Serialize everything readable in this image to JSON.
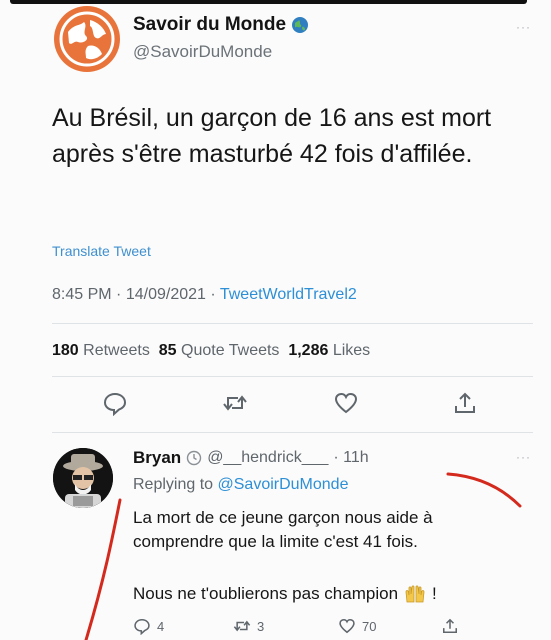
{
  "tweet": {
    "author_name": "Savoir du Monde",
    "author_handle": "@SavoirDuMonde",
    "text": "Au Brésil, un garçon de 16 ans est mort après s'être masturbé 42 fois d'affilée.",
    "translate_label": "Translate Tweet",
    "time": "8:45 PM",
    "date": "14/09/2021",
    "source": "TweetWorldTravel2",
    "retweets_count": "180",
    "retweets_label": "Retweets",
    "quotes_count": "85",
    "quotes_label": "Quote Tweets",
    "likes_count": "1,286",
    "likes_label": "Likes",
    "more": "···"
  },
  "reply": {
    "author_name": "Bryan",
    "author_handle": "@__hendrick___",
    "time": "· 11h",
    "replying_prefix": "Replying to",
    "replying_to": "@SavoirDuMonde",
    "text_line1": "La mort de ce jeune garçon nous aide à comprendre que la limite c'est 41 fois.",
    "text_line2": "Nous ne t'oublierons pas champion",
    "exclaim": "!",
    "reply_count": "4",
    "retweet_count": "3",
    "like_count": "70",
    "more": "···"
  },
  "colors": {
    "accent": "#2d8fd6",
    "muted": "#5f666c",
    "annotation": "#d42a1e",
    "globe_orange": "#e8743b"
  },
  "icons": [
    "globe-avatar-icon",
    "verified-globe-icon",
    "reply-icon",
    "retweet-icon",
    "like-icon",
    "share-icon",
    "clock-icon",
    "raised-hands-emoji-icon"
  ]
}
